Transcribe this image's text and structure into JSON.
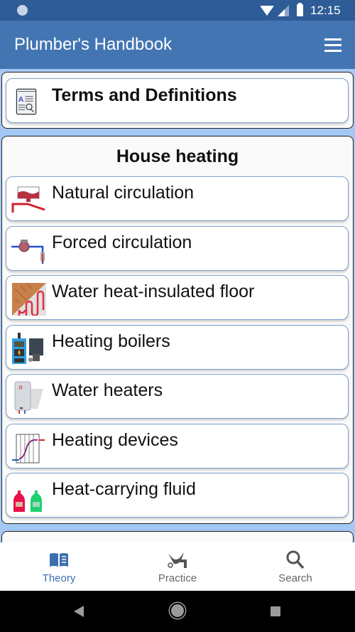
{
  "status_bar": {
    "time": "12:15",
    "icons": [
      "notification-dot-icon",
      "wifi-icon",
      "signal-icon",
      "battery-icon"
    ]
  },
  "app_bar": {
    "title": "Plumber's Handbook",
    "menu_icon": "hamburger-menu-icon"
  },
  "terms_card": {
    "label": "Terms and Definitions",
    "icon": "dictionary-book-icon"
  },
  "house_heating": {
    "title": "House heating",
    "items": [
      {
        "label": "Natural circulation",
        "icon": "natural-circulation-icon"
      },
      {
        "label": "Forced circulation",
        "icon": "circulation-pump-icon"
      },
      {
        "label": "Water heat-insulated floor",
        "icon": "heated-floor-icon"
      },
      {
        "label": "Heating boilers",
        "icon": "boiler-icon"
      },
      {
        "label": "Water heaters",
        "icon": "water-heater-icon"
      },
      {
        "label": "Heating devices",
        "icon": "radiator-icon"
      },
      {
        "label": "Heat-carrying fluid",
        "icon": "fluid-canisters-icon"
      }
    ]
  },
  "bottom_nav": {
    "items": [
      {
        "label": "Theory",
        "icon": "open-book-icon",
        "active": true
      },
      {
        "label": "Practice",
        "icon": "plumbing-tools-icon",
        "active": false
      },
      {
        "label": "Search",
        "icon": "search-icon",
        "active": false
      }
    ]
  },
  "colors": {
    "primary": "#4375b3",
    "status_bar": "#2d5c97",
    "background": "#a4c8f4",
    "active_tab": "#3d6fb0"
  }
}
